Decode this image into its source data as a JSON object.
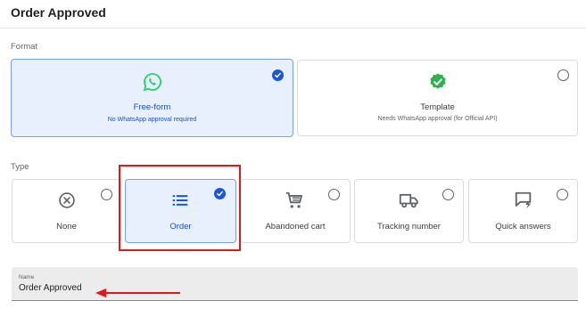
{
  "header": {
    "title": "Order Approved"
  },
  "format": {
    "label": "Format",
    "options": [
      {
        "title": "Free-form",
        "subtitle": "No WhatsApp approval required",
        "icon": "whatsapp-icon",
        "selected": true
      },
      {
        "title": "Template",
        "subtitle": "Needs WhatsApp approval (for Official API)",
        "icon": "verified-badge-icon",
        "selected": false
      }
    ]
  },
  "type": {
    "label": "Type",
    "options": [
      {
        "title": "None",
        "icon": "cancel-circle-icon",
        "selected": false
      },
      {
        "title": "Order",
        "icon": "list-icon",
        "selected": true
      },
      {
        "title": "Abandoned cart",
        "icon": "cart-icon",
        "selected": false
      },
      {
        "title": "Tracking number",
        "icon": "truck-icon",
        "selected": false
      },
      {
        "title": "Quick answers",
        "icon": "quick-reply-icon",
        "selected": false
      }
    ]
  },
  "name_field": {
    "label": "Name",
    "value": "Order Approved"
  },
  "colors": {
    "accent": "#1a56db",
    "selected_bg": "#e8f0fe",
    "whatsapp": "#25d366",
    "highlight": "#e01919"
  }
}
